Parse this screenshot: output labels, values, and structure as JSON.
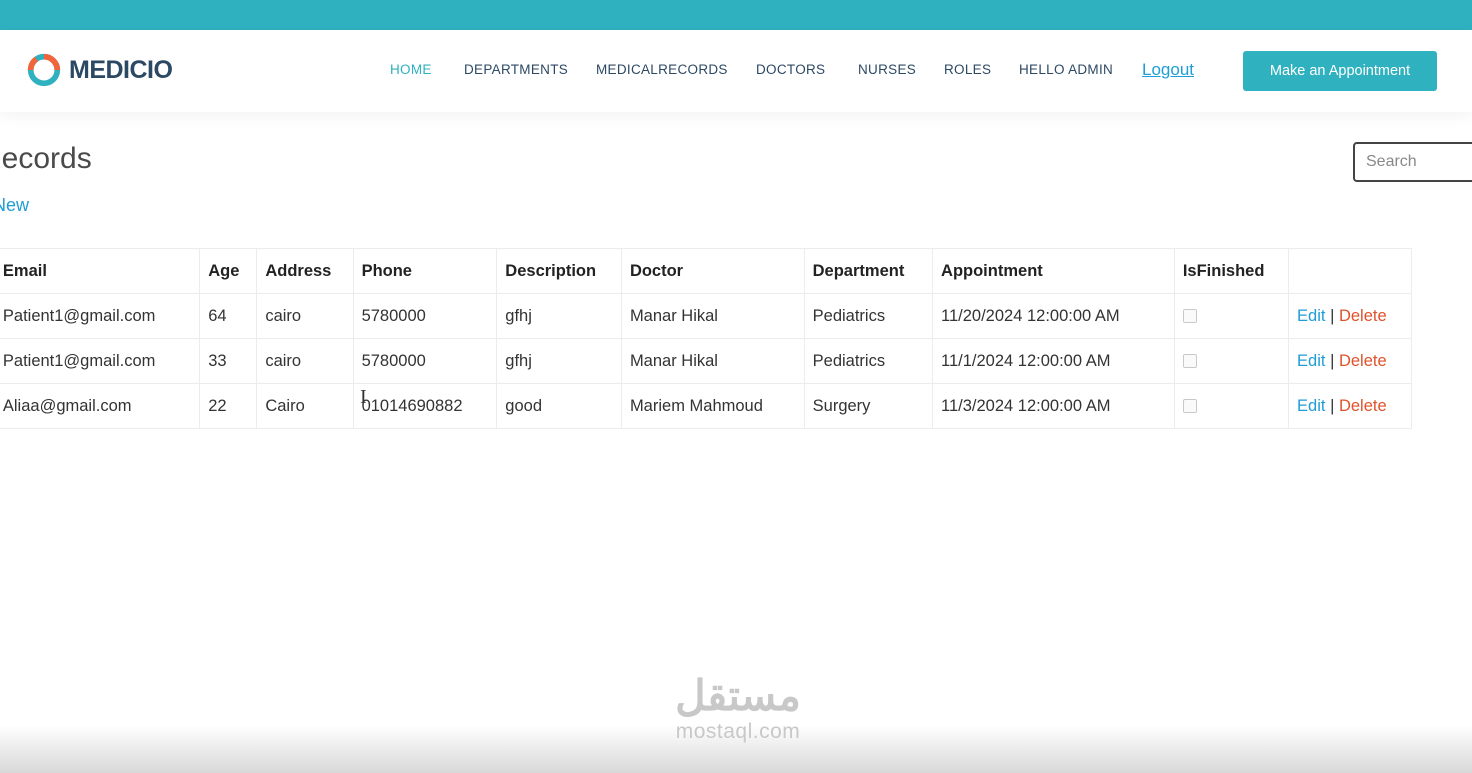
{
  "brand": {
    "name": "MEDICIO",
    "logo_icon": "ring-logo-icon"
  },
  "colors": {
    "accent": "#2fb1bf",
    "link": "#1e9dd6",
    "danger": "#e0522b"
  },
  "nav": {
    "items": [
      {
        "label": "HOME",
        "active": true
      },
      {
        "label": "DEPARTMENTS",
        "active": false
      },
      {
        "label": "MEDICALRECORDS",
        "active": false
      },
      {
        "label": "DOCTORS",
        "active": false
      },
      {
        "label": "NURSES",
        "active": false
      },
      {
        "label": "ROLES",
        "active": false
      },
      {
        "label": "HELLO ADMIN",
        "active": false
      }
    ],
    "logout_label": "Logout",
    "appointment_button": "Make an Appointment"
  },
  "page": {
    "title": "Records",
    "new_link": "New"
  },
  "search": {
    "placeholder": "Search",
    "value": ""
  },
  "table": {
    "columns": [
      "Email",
      "Age",
      "Address",
      "Phone",
      "Description",
      "Doctor",
      "Department",
      "Appointment",
      "IsFinished",
      ""
    ],
    "rows": [
      {
        "email": "Patient1@gmail.com",
        "age": "64",
        "address": "cairo",
        "phone": "5780000",
        "description": "gfhj",
        "doctor": "Manar Hikal",
        "department": "Pediatrics",
        "appointment": "11/20/2024 12:00:00 AM",
        "is_finished": false,
        "edit": "Edit",
        "delete": "Delete"
      },
      {
        "email": "Patient1@gmail.com",
        "age": "33",
        "address": "cairo",
        "phone": "5780000",
        "description": "gfhj",
        "doctor": "Manar Hikal",
        "department": "Pediatrics",
        "appointment": "11/1/2024 12:00:00 AM",
        "is_finished": false,
        "edit": "Edit",
        "delete": "Delete"
      },
      {
        "email": "Aliaa@gmail.com",
        "age": "22",
        "address": "Cairo",
        "phone": "01014690882",
        "description": "good",
        "doctor": "Mariem Mahmoud",
        "department": "Surgery",
        "appointment": "11/3/2024 12:00:00 AM",
        "is_finished": false,
        "edit": "Edit",
        "delete": "Delete"
      }
    ]
  },
  "watermark": {
    "arabic": "مستقل",
    "latin": "mostaql.com"
  }
}
